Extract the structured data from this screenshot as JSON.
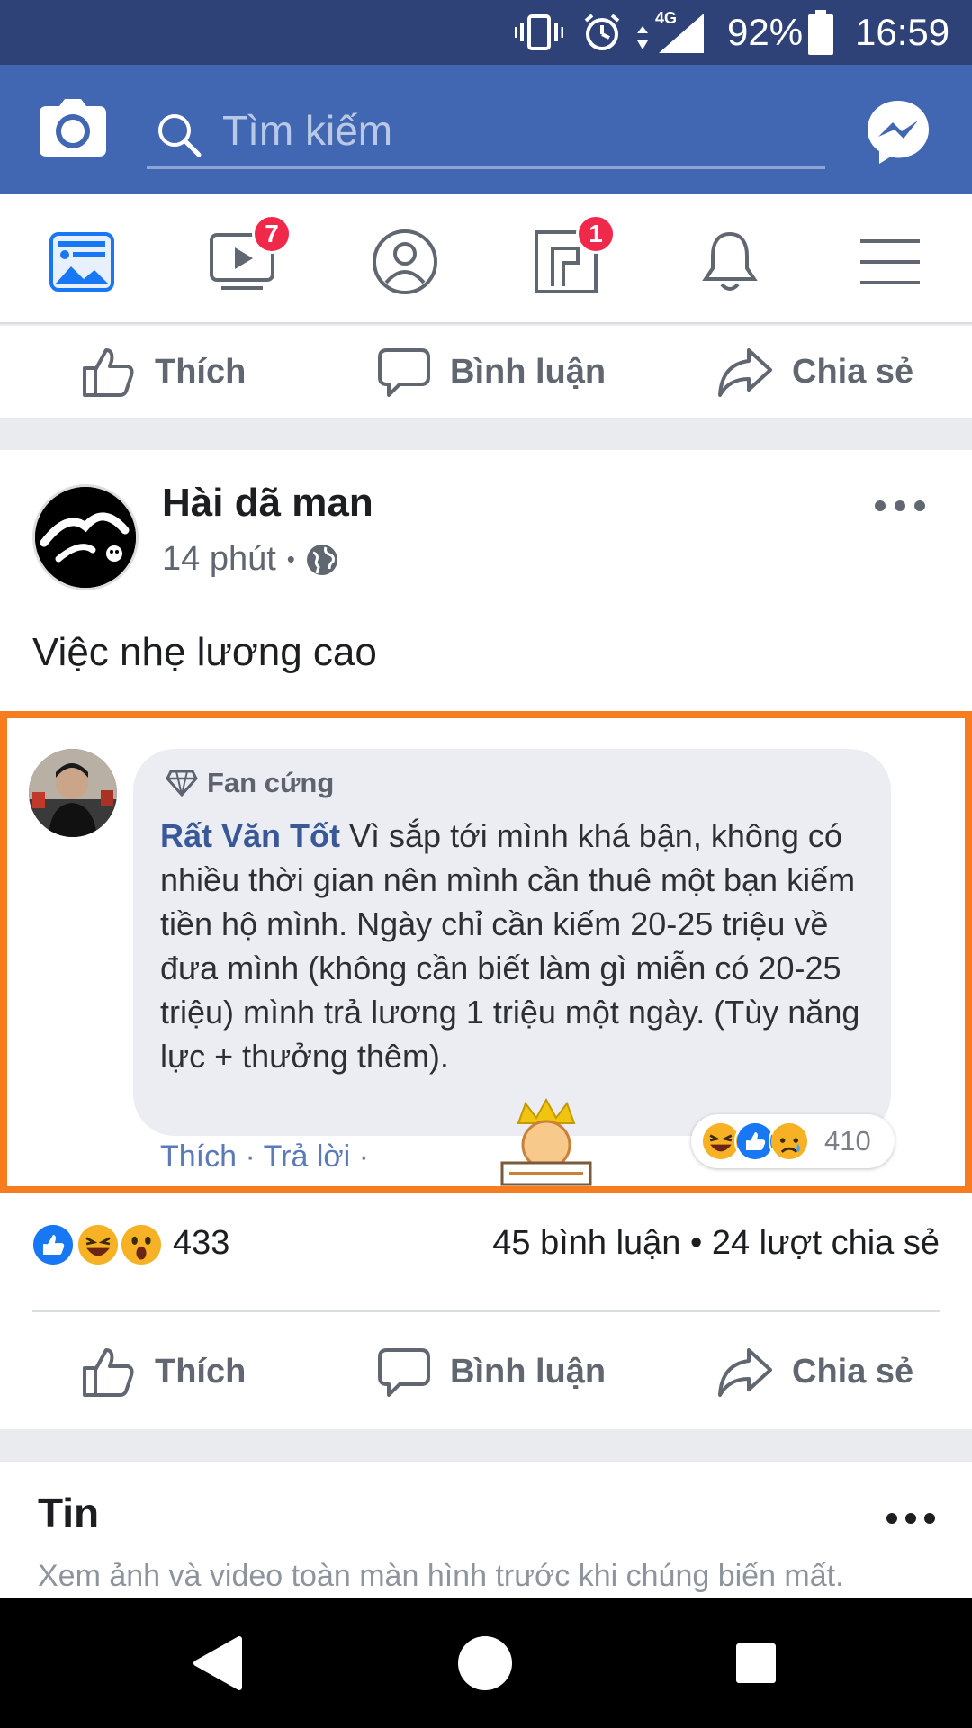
{
  "status_bar": {
    "network": "4G",
    "battery": "92%",
    "time": "16:59"
  },
  "header": {
    "search_placeholder": "Tìm kiếm"
  },
  "nav": {
    "watch_badge": "7",
    "pages_badge": "1"
  },
  "top_actions": {
    "like": "Thích",
    "comment": "Bình luận",
    "share": "Chia sẻ"
  },
  "post": {
    "page_name": "Hài dã man",
    "time": "14 phút",
    "separator": "•",
    "text": "Việc nhẹ lương cao",
    "embedded_comment": {
      "badge": "Fan cứng",
      "author": "Rất Văn Tốt",
      "body": " Vì sắp tới mình khá bận, không có nhiều thời gian nên mình cần thuê một bạn kiếm tiền hộ mình. Ngày chỉ cần kiếm 20-25 triệu về đưa mình (không cần biết làm gì miễn có 20-25 triệu) mình trả lương 1 triệu một ngày. (Tùy năng lực + thưởng thêm).",
      "actions": "Thích · Trả lời ·",
      "reaction_count": "410"
    },
    "reaction_count": "433",
    "stats": "45 bình luận • 24 lượt chia sẻ",
    "actions": {
      "like": "Thích",
      "comment": "Bình luận",
      "share": "Chia sẻ"
    }
  },
  "stories": {
    "title": "Tin",
    "subtitle": "Xem ảnh và video toàn màn hình trước khi chúng biến mất."
  },
  "colors": {
    "header": "#4267b2",
    "status": "#2e4278",
    "accent": "#f57d1f",
    "badge": "#f02849"
  }
}
